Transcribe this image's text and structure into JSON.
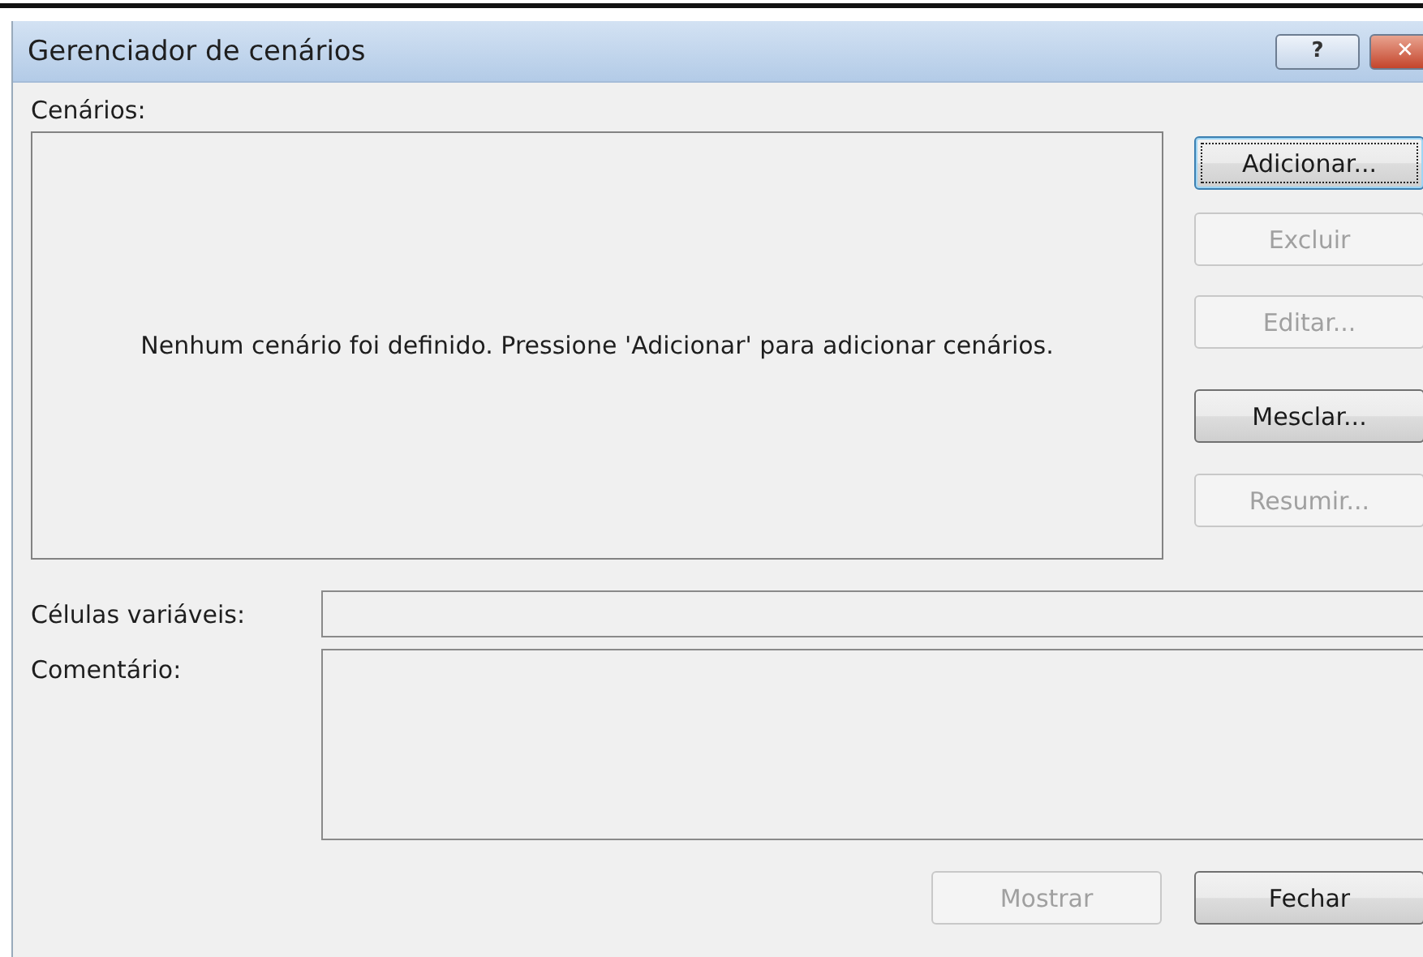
{
  "window": {
    "title": "Gerenciador de cenários",
    "title_buttons": [
      {
        "kind": "help",
        "label": "?"
      },
      {
        "kind": "close",
        "label": "✕"
      }
    ]
  },
  "scenarios": {
    "label": "Cenários:",
    "empty_message": "Nenhum cenário foi definido. Pressione 'Adicionar' para adicionar cenários."
  },
  "side_buttons": [
    {
      "label": "Adicionar...",
      "disabled": false,
      "focused": true
    },
    {
      "label": "Excluir",
      "disabled": true,
      "focused": false
    },
    {
      "label": "Editar...",
      "disabled": true,
      "focused": false
    },
    {
      "label": "Mesclar...",
      "disabled": false,
      "focused": false
    },
    {
      "label": "Resumir...",
      "disabled": true,
      "focused": false
    }
  ],
  "changing_cells": {
    "label": "Células variáveis:"
  },
  "comment": {
    "label": "Comentário:"
  },
  "bottom_buttons": [
    {
      "label": "Mostrar",
      "disabled": true,
      "focused": false
    },
    {
      "label": "Fechar",
      "disabled": false,
      "focused": false
    }
  ]
}
